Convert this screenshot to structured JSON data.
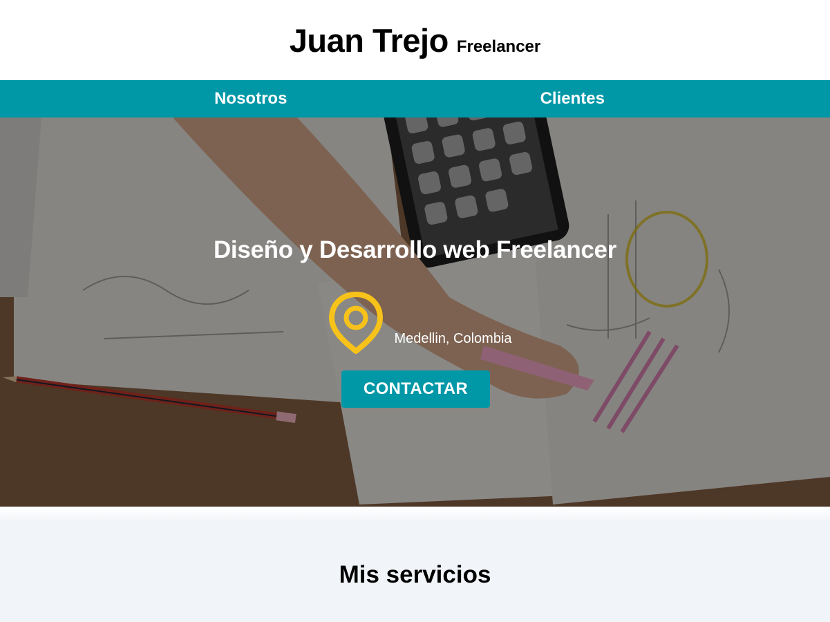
{
  "header": {
    "name": "Juan Trejo",
    "role": "Freelancer"
  },
  "nav": {
    "items": [
      {
        "label": "Nosotros"
      },
      {
        "label": "Clientes"
      }
    ]
  },
  "hero": {
    "title": "Diseño y Desarrollo web Freelancer",
    "location": "Medellin, Colombia",
    "location_icon": "map-pin-icon",
    "cta_label": "CONTACTAR"
  },
  "services": {
    "title": "Mis servicios"
  },
  "colors": {
    "accent": "#0097a7",
    "pin": "#f7c21a",
    "services_bg": "#f1f4f8"
  }
}
